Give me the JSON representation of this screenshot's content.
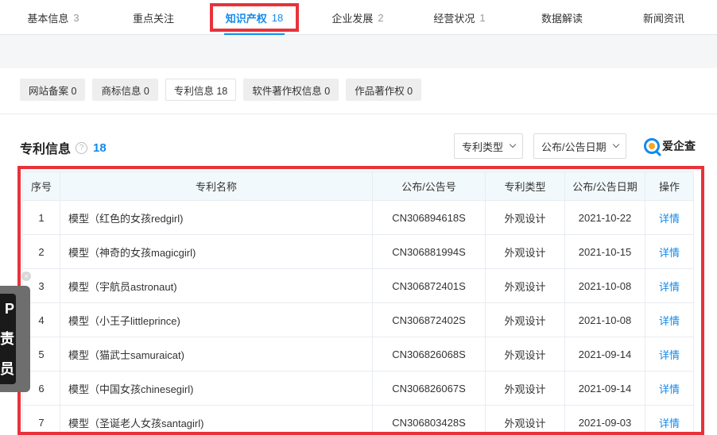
{
  "top_tabs": [
    {
      "label": "基本信息",
      "count": "3"
    },
    {
      "label": "重点关注",
      "count": ""
    },
    {
      "label": "知识产权",
      "count": "18"
    },
    {
      "label": "企业发展",
      "count": "2"
    },
    {
      "label": "经营状况",
      "count": "1"
    },
    {
      "label": "数据解读",
      "count": ""
    },
    {
      "label": "新闻资讯",
      "count": ""
    }
  ],
  "sub_tabs": [
    "网站备案 0",
    "商标信息 0",
    "专利信息 18",
    "软件著作权信息 0",
    "作品著作权 0"
  ],
  "section": {
    "title": "专利信息",
    "help": "?",
    "count": "18"
  },
  "filters": {
    "patent_type": "专利类型",
    "pub_date": "公布/公告日期"
  },
  "brand": {
    "name": "爱企查"
  },
  "table": {
    "headers": [
      "序号",
      "专利名称",
      "公布/公告号",
      "专利类型",
      "公布/公告日期",
      "操作"
    ],
    "rows": [
      {
        "no": "1",
        "name": "模型（红色的女孩redgirl)",
        "pub_no": "CN306894618S",
        "type": "外观设计",
        "date": "2021-10-22",
        "op": "详情"
      },
      {
        "no": "2",
        "name": "模型（神奇的女孩magicgirl)",
        "pub_no": "CN306881994S",
        "type": "外观设计",
        "date": "2021-10-15",
        "op": "详情"
      },
      {
        "no": "3",
        "name": "模型（宇航员astronaut)",
        "pub_no": "CN306872401S",
        "type": "外观设计",
        "date": "2021-10-08",
        "op": "详情"
      },
      {
        "no": "4",
        "name": "模型（小王子littleprince)",
        "pub_no": "CN306872402S",
        "type": "外观设计",
        "date": "2021-10-08",
        "op": "详情"
      },
      {
        "no": "5",
        "name": "模型（猫武士samuraicat)",
        "pub_no": "CN306826068S",
        "type": "外观设计",
        "date": "2021-09-14",
        "op": "详情"
      },
      {
        "no": "6",
        "name": "模型（中国女孩chinesegirl)",
        "pub_no": "CN306826067S",
        "type": "外观设计",
        "date": "2021-09-14",
        "op": "详情"
      },
      {
        "no": "7",
        "name": "模型（圣诞老人女孩santagirl)",
        "pub_no": "CN306803428S",
        "type": "外观设计",
        "date": "2021-09-03",
        "op": "详情"
      }
    ]
  },
  "float_widget": {
    "close": "×",
    "text_1": "P",
    "text_2": "责",
    "text_3": "员"
  },
  "colors": {
    "accent": "#128bed",
    "highlight": "#e8323a"
  }
}
